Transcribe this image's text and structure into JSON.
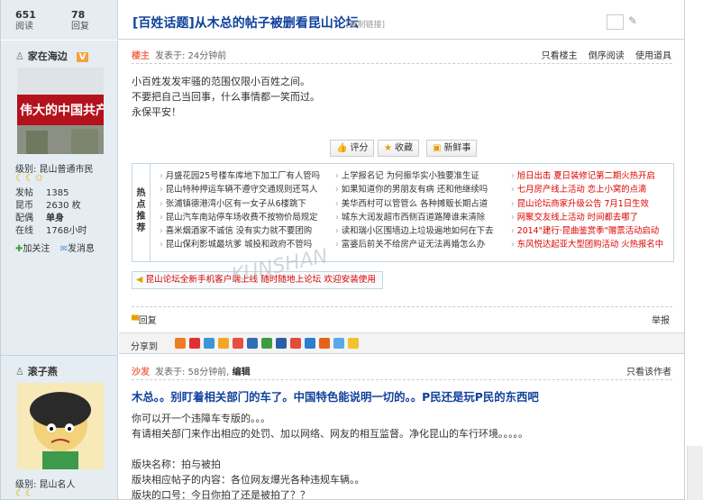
{
  "stats": {
    "views": "651",
    "views_label": "阅读",
    "replies": "78",
    "replies_label": "回复"
  },
  "thread": {
    "title": "[百姓话题]从木总的帖子被删看昆山论坛",
    "copy_link": "[复制链接]"
  },
  "post1": {
    "author": "家在海边",
    "vip": "V",
    "level": "级别: 昆山普通市民",
    "stars": "☾☾✩",
    "fields": [
      {
        "k": "发帖",
        "v": "1385"
      },
      {
        "k": "昆币",
        "v": "2630 枚"
      },
      {
        "k": "配偶",
        "v": "单身"
      },
      {
        "k": "在线",
        "v": "1768小时"
      }
    ],
    "follow": "加关注",
    "message": "发消息",
    "floor": "楼主",
    "posted": "发表于: 24分钟前",
    "links": [
      "只看楼主",
      "倒序阅读",
      "使用道具"
    ],
    "lines": [
      "小百姓发发牢骚的范围仅限小百姓之间。",
      "不要把自己当回事，什么事情都一笑而过。",
      "永保平安！"
    ],
    "buttons": [
      "评分",
      "收藏",
      "新鲜事"
    ],
    "avatar_text": "伟大的中国共产党"
  },
  "hot": {
    "label": "热点推荐",
    "col1": [
      "月盛花园25号楼车库地下加工厂有人管吗",
      "昆山特种押运车辆不遵守交通规则还骂人",
      "张浦镇德港湾小区有一女子从6楼跳下",
      "昆山汽车南站停车场收费不按物价局规定",
      "喜米烟酒家不诚信 没有实力就不要团购",
      "昆山保利影城最坑爹 城投和政府不管吗"
    ],
    "col2": [
      "上学报名记 为何振华实小独要准生证",
      "如果知道你的男朋友有病 还和他继续吗",
      "美华西村可以管管么 各种摊贩长期占道",
      "城东大润发超市西侧百道路障谁来清除",
      "读和瑞小区围墙边上垃圾遍地如何在下去",
      "富婆后前关不给房产证无法再婚怎么办"
    ],
    "col3": [
      "旭日出击 夏日装修记第二期火热开启",
      "七月房产线上活动 恋上小窝的点滴",
      "昆山论坛商家升级公告 7月1日生效",
      "网聚交友线上活动 时间都去哪了",
      "2014\"建行·昆曲鉴赏季\"赠票活动启动",
      "东风悦达起亚大型团购活动 火热报名中"
    ]
  },
  "promo": "昆山论坛全新手机客户端上线 随时随地上论坛 欢迎安装使用",
  "reply": "回复",
  "report": "举报",
  "share": "分享到",
  "watermark": "KUNSHAN",
  "post2": {
    "author": "滚子燕",
    "level": "级别: 昆山名人",
    "stars": "☾☾",
    "floor": "沙发",
    "posted": "发表于: 58分钟前",
    "edit": "编辑",
    "links": [
      "只看该作者"
    ],
    "title": "木总。。别盯着相关部门的车了。中国特色能说明一切的。。P民还是玩P民的东西吧",
    "lines": [
      "你可以开一个违障车专版的。。。",
      "有请相关部门来作出相应的处罚、加以网络、网友的相互监督。净化昆山的车行环境。。。。。",
      "",
      "版块名称：拍与被拍",
      "版块相应帖子的内容：各位网友爆光各种违规车辆。。",
      "版块的口号：今日你拍了还是被拍了？？"
    ]
  },
  "colors": {
    "link": "#10419c",
    "red": "#dd0000",
    "side": "#e5edf2",
    "floor": "#f26c4f"
  }
}
